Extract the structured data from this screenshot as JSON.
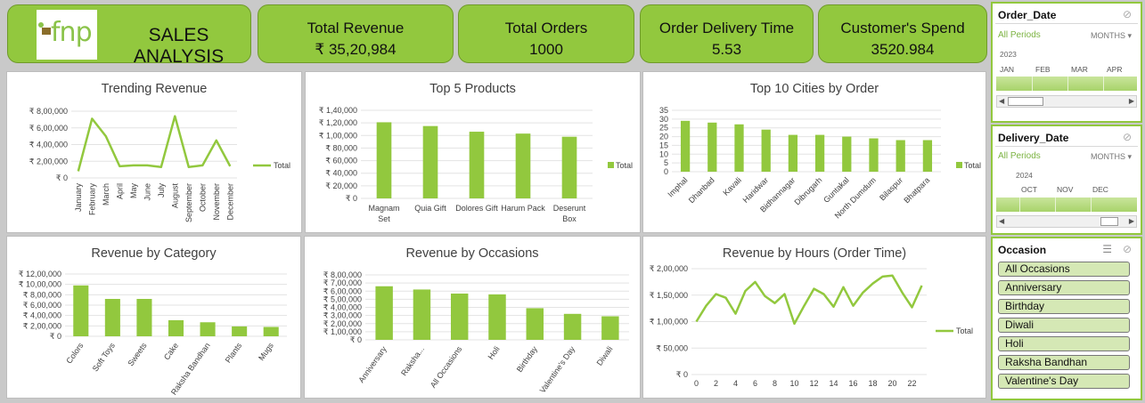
{
  "header": {
    "logo_text": "fnp",
    "title": "SALES ANALYSIS"
  },
  "kpis": [
    {
      "title": "Total Revenue",
      "value": "₹ 35,20,984"
    },
    {
      "title": "Total Orders",
      "value": "1000"
    },
    {
      "title": "Order Delivery Time",
      "value": "5.53"
    },
    {
      "title": "Customer's Spend",
      "value": "3520.984"
    }
  ],
  "colors": {
    "accent": "#92c83e",
    "bar": "#92c83e",
    "panel_bg": "#ffffff",
    "page_bg": "#c9c9c9"
  },
  "chart_data": [
    {
      "id": "trend",
      "type": "line",
      "title": "Trending Revenue",
      "categories": [
        "January",
        "February",
        "March",
        "April",
        "May",
        "June",
        "July",
        "August",
        "September",
        "October",
        "November",
        "December"
      ],
      "series": [
        {
          "name": "Total",
          "values": [
            80000,
            710000,
            500000,
            140000,
            150000,
            150000,
            130000,
            740000,
            130000,
            150000,
            450000,
            140000
          ]
        }
      ],
      "yticks": [
        "₹ 8,00,000",
        "₹ 6,00,000",
        "₹ 4,00,000",
        "₹ 2,00,000",
        "₹ 0"
      ],
      "ylim": [
        0,
        800000
      ],
      "legend": "right"
    },
    {
      "id": "products",
      "type": "bar",
      "title": "Top 5 Products",
      "categories": [
        "Magnam Set",
        "Quia Gift",
        "Dolores Gift",
        "Harum Pack",
        "Deserunt Box"
      ],
      "series": [
        {
          "name": "Total",
          "values": [
            121000,
            115000,
            106000,
            103000,
            98000
          ]
        }
      ],
      "yticks": [
        "₹ 1,40,000",
        "₹ 1,20,000",
        "₹ 1,00,000",
        "₹ 80,000",
        "₹ 60,000",
        "₹ 40,000",
        "₹ 20,000",
        "₹ 0"
      ],
      "ylim": [
        0,
        140000
      ],
      "legend": "right"
    },
    {
      "id": "cities",
      "type": "bar",
      "title": "Top 10 Cities by Order",
      "categories": [
        "Imphal",
        "Dhanbad",
        "Kavali",
        "Haridwar",
        "Bidhannagar",
        "Dibrugarh",
        "Guntakal",
        "North Dumdum",
        "Bilaspur",
        "Bhatpara"
      ],
      "series": [
        {
          "name": "Total",
          "values": [
            29,
            28,
            27,
            24,
            21,
            21,
            20,
            19,
            18,
            18
          ]
        }
      ],
      "yticks": [
        "35",
        "30",
        "25",
        "20",
        "15",
        "10",
        "5",
        "0"
      ],
      "ylim": [
        0,
        35
      ],
      "legend": "right"
    },
    {
      "id": "category",
      "type": "bar",
      "title": "Revenue by Category",
      "categories": [
        "Colors",
        "Soft Toys",
        "Sweets",
        "Cake",
        "Raksha Bandhan",
        "Plants",
        "Mugs"
      ],
      "series": [
        {
          "name": "Total",
          "values": [
            980000,
            720000,
            720000,
            310000,
            270000,
            190000,
            180000
          ]
        }
      ],
      "yticks": [
        "₹ 12,00,000",
        "₹ 10,00,000",
        "₹ 8,00,000",
        "₹ 6,00,000",
        "₹ 4,00,000",
        "₹ 2,00,000",
        "₹ 0"
      ],
      "ylim": [
        0,
        1200000
      ]
    },
    {
      "id": "occasions",
      "type": "bar",
      "title": "Revenue by Occasions",
      "categories": [
        "Anniversary",
        "Raksha...",
        "All Occasions",
        "Holi",
        "Birthday",
        "Valentine's Day",
        "Diwali"
      ],
      "series": [
        {
          "name": "Total",
          "values": [
            660000,
            620000,
            570000,
            560000,
            390000,
            320000,
            290000
          ]
        }
      ],
      "yticks": [
        "₹ 8,00,000",
        "₹ 7,00,000",
        "₹ 6,00,000",
        "₹ 5,00,000",
        "₹ 4,00,000",
        "₹ 3,00,000",
        "₹ 2,00,000",
        "₹ 1,00,000",
        "₹ 0"
      ],
      "ylim": [
        0,
        800000
      ]
    },
    {
      "id": "hours",
      "type": "line",
      "title": "Revenue by Hours (Order Time)",
      "x": [
        0,
        1,
        2,
        3,
        4,
        5,
        6,
        7,
        8,
        9,
        10,
        11,
        12,
        13,
        14,
        15,
        16,
        17,
        18,
        19,
        20,
        21,
        22,
        23
      ],
      "xticks": [
        "0",
        "2",
        "4",
        "6",
        "8",
        "10",
        "12",
        "14",
        "16",
        "18",
        "20",
        "22"
      ],
      "series": [
        {
          "name": "Total",
          "values": [
            100000,
            130000,
            152000,
            145000,
            115000,
            158000,
            175000,
            148000,
            135000,
            152000,
            96000,
            130000,
            162000,
            152000,
            128000,
            165000,
            130000,
            155000,
            172000,
            185000,
            187000,
            155000,
            127000,
            168000
          ]
        }
      ],
      "yticks": [
        "₹ 2,00,000",
        "₹ 1,50,000",
        "₹ 1,00,000",
        "₹ 50,000",
        "₹ 0"
      ],
      "ylim": [
        0,
        200000
      ],
      "legend": "right"
    }
  ],
  "slicers": {
    "order_date": {
      "title": "Order_Date",
      "all_periods": "All Periods",
      "unit": "MONTHS",
      "year": "2023",
      "months": [
        "JAN",
        "FEB",
        "MAR",
        "APR"
      ]
    },
    "delivery_date": {
      "title": "Delivery_Date",
      "all_periods": "All Periods",
      "unit": "MONTHS",
      "year": "2024",
      "months": [
        "OCT",
        "NOV",
        "DEC"
      ]
    },
    "occasion": {
      "title": "Occasion",
      "items": [
        "All Occasions",
        "Anniversary",
        "Birthday",
        "Diwali",
        "Holi",
        "Raksha Bandhan",
        "Valentine's Day"
      ]
    }
  }
}
